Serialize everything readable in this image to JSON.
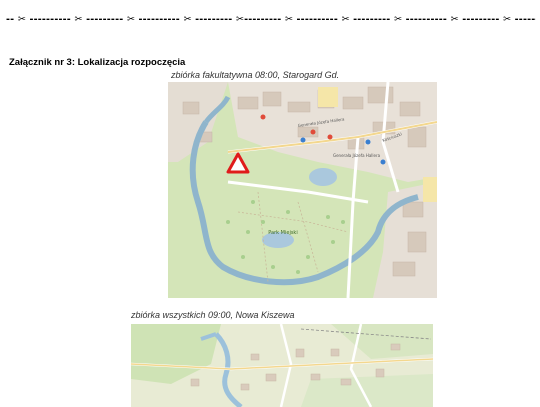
{
  "cut_line": {
    "text": "--  ✂ ---------- ✂ --------- ✂ ---------- ✂ --------- ✂--------- ✂ ---------- ✂ --------- ✂ ---------- ✂ --------- ✂ --------"
  },
  "heading": "Załącznik nr 3: Lokalizacja rozpoczęcia",
  "map1": {
    "caption": "zbiórka fakultatywna 08:00, Starogard Gd.",
    "labels": {
      "park": "Park Miejski",
      "street1": "Generała Józefa Hallera",
      "street2": "Generała Józefa Hallera",
      "street3": "Kościuszki"
    },
    "marker_icon": "warning-triangle-icon"
  },
  "map2": {
    "caption": "zbiórka wszystkich 09:00, Nowa Kiszewa"
  }
}
